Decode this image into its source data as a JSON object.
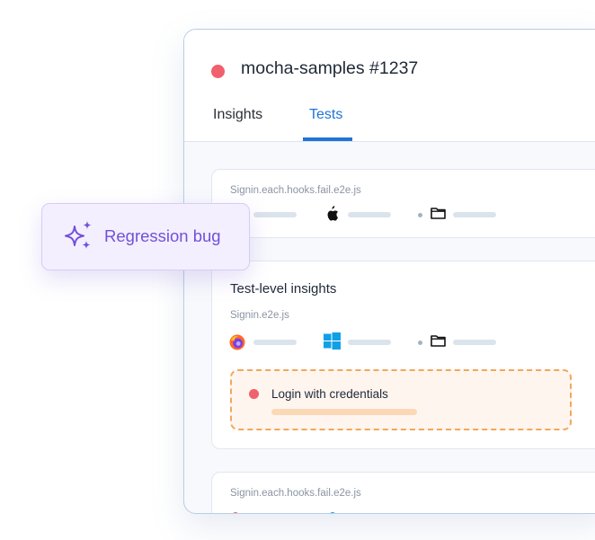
{
  "run": {
    "status_color": "#f0606d",
    "title": "mocha-samples #1237"
  },
  "tabs": [
    {
      "label": "Insights",
      "active": false
    },
    {
      "label": "Tests",
      "active": true
    }
  ],
  "cards": [
    {
      "file": "Signin.each.hooks.fail.e2e.js",
      "meta": [
        "apple-icon",
        "folder-icon"
      ]
    },
    {
      "title": "Test-level insights",
      "file": "Signin.e2e.js",
      "meta": [
        "firefox-icon",
        "windows-icon",
        "folder-icon"
      ],
      "finding": {
        "label": "Login with credentials",
        "status_color": "#f0606d"
      }
    },
    {
      "file": "Signin.each.hooks.fail.e2e.js"
    }
  ],
  "badge": {
    "icon": "sparkle-icon",
    "label": "Regression bug",
    "color": "#7250d8"
  }
}
